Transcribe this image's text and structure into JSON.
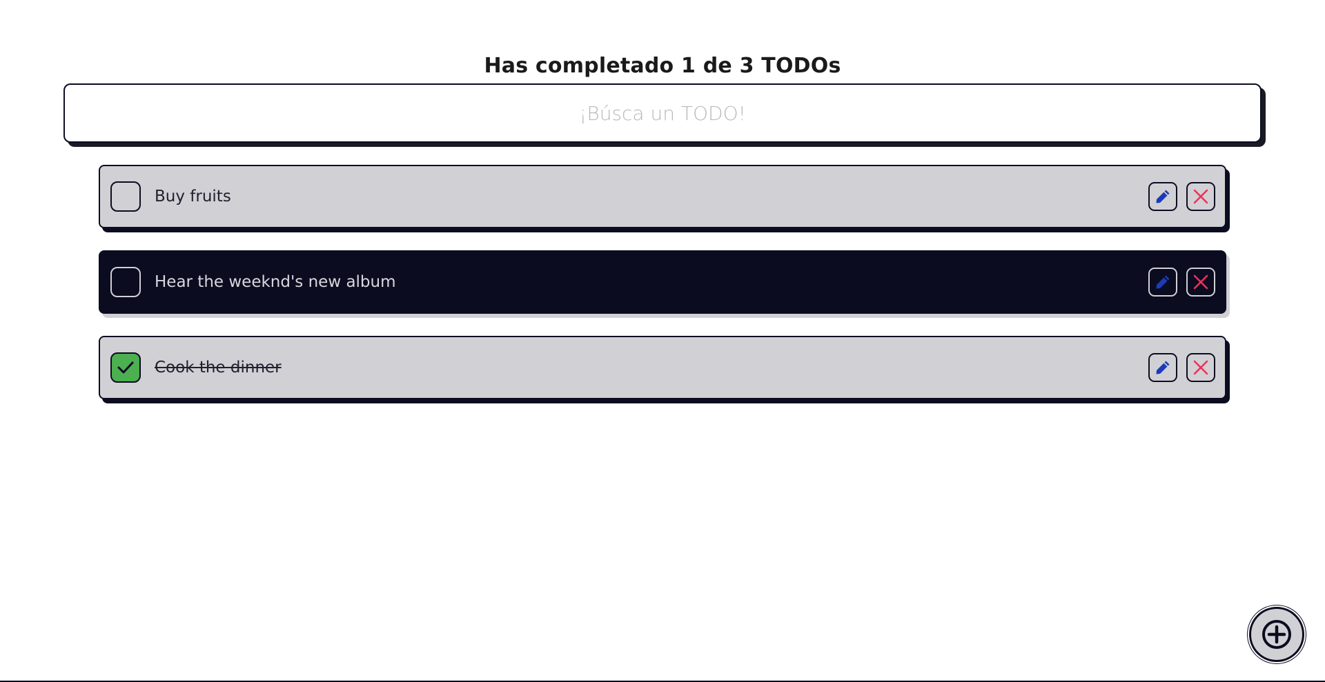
{
  "header": {
    "title": "Has completado 1 de 3 TODOs"
  },
  "search": {
    "placeholder": "¡Búsca un TODO!",
    "value": ""
  },
  "todos": [
    {
      "text": "Buy fruits",
      "completed": false,
      "highlighted": false
    },
    {
      "text": "Hear the weeknd's new album",
      "completed": false,
      "highlighted": true
    },
    {
      "text": "Cook the dinner",
      "completed": true,
      "highlighted": false
    }
  ],
  "icons": {
    "edit": "pencil-icon",
    "delete": "close-icon",
    "check": "check-icon",
    "add": "plus-icon"
  },
  "colors": {
    "dark": "#0b0c20",
    "light_gray": "#d1d0d5",
    "edit_blue": "#1c3bb8",
    "delete_red": "#f0305a",
    "done_green": "#4caf50"
  }
}
